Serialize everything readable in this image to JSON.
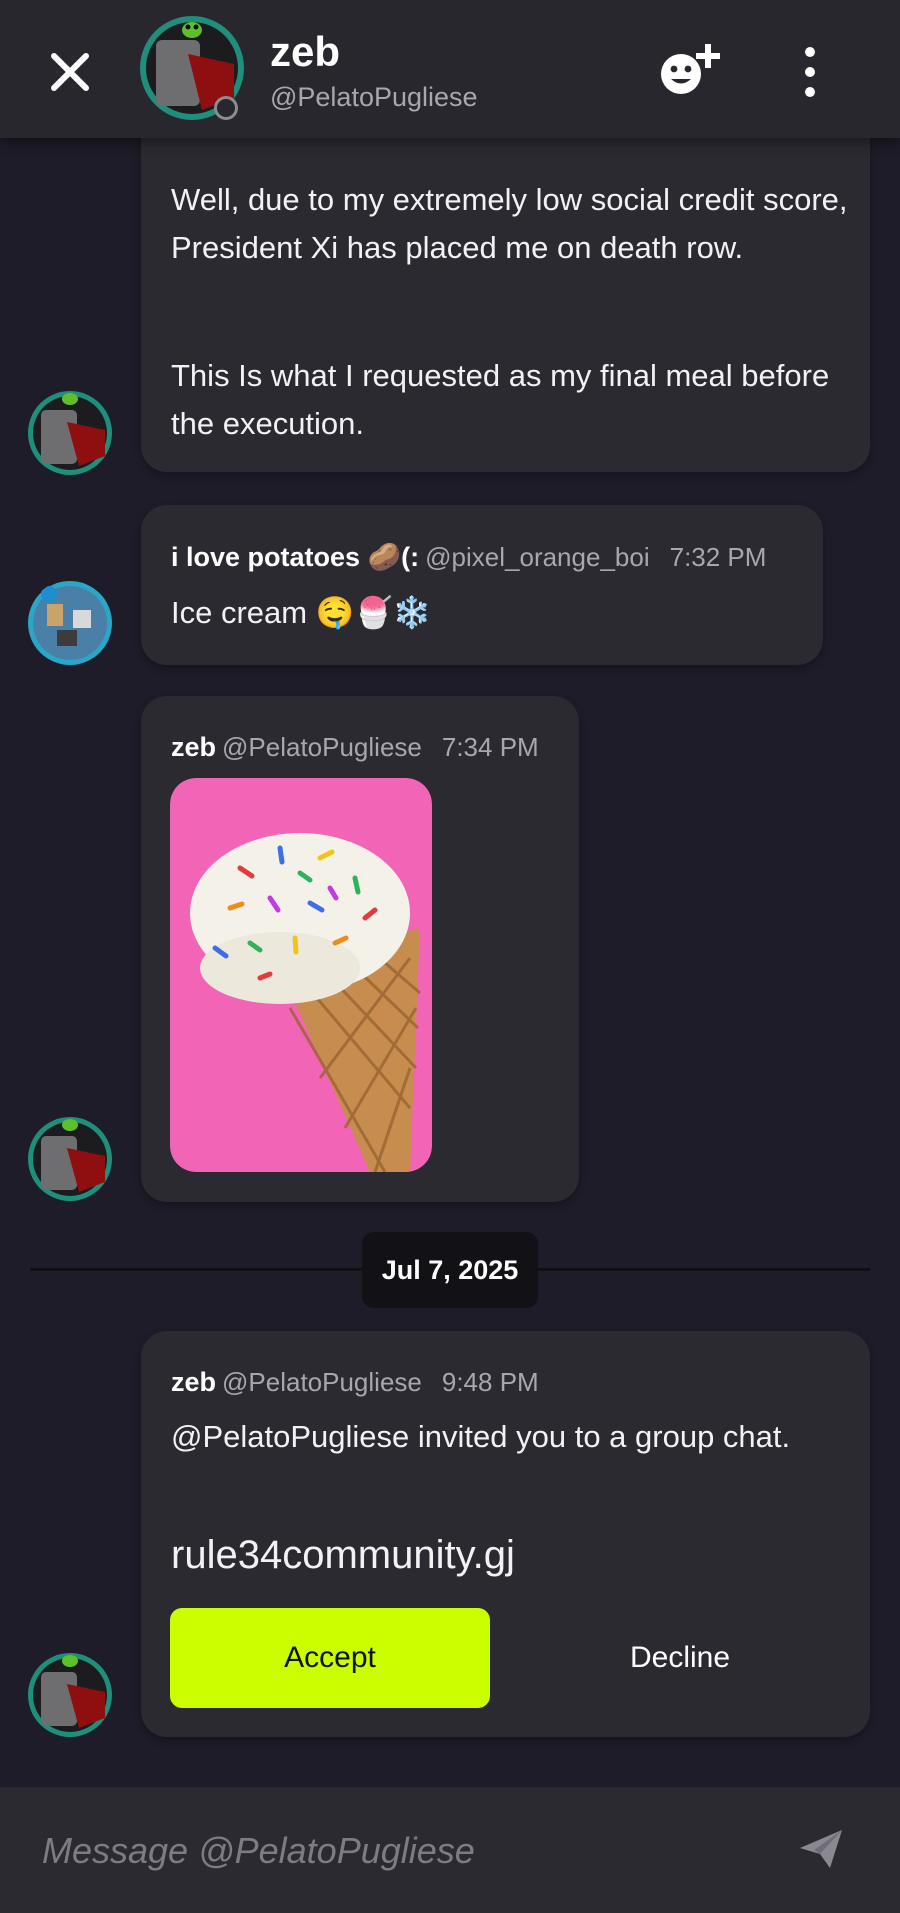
{
  "header": {
    "name": "zeb",
    "handle": "@PelatoPugliese"
  },
  "messages": [
    {
      "paragraphs": [
        "Well, due to my extremely low social credit score, President Xi has placed me on death row.",
        "This Is what I requested as my final meal before the execution."
      ]
    },
    {
      "author": "i love potatoes 🥔(:",
      "handle": "@pixel_orange_boi",
      "time": "7:32 PM",
      "text": "Ice cream 🤤🍧❄️"
    },
    {
      "author": "zeb",
      "handle": "@PelatoPugliese",
      "time": "7:34 PM",
      "image": "ice-cream-cone-photo"
    }
  ],
  "date_divider": "Jul 7, 2025",
  "invite": {
    "author": "zeb",
    "handle": "@PelatoPugliese",
    "time": "9:48 PM",
    "text": "@PelatoPugliese invited you to a group chat.",
    "group_name": "rule34community.gj",
    "accept_label": "Accept",
    "decline_label": "Decline"
  },
  "composer": {
    "placeholder": "Message @PelatoPugliese"
  },
  "colors": {
    "background": "#1d1c28",
    "card": "#2b2a31",
    "accent": "#cbff00",
    "muted_text": "#a7a7ad"
  }
}
